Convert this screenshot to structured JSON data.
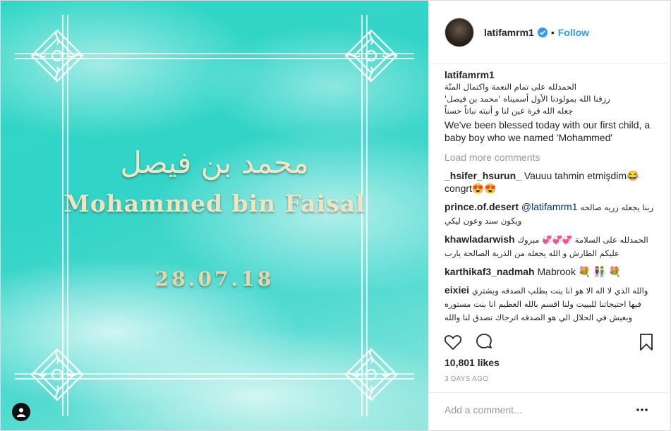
{
  "post": {
    "image": {
      "title_arabic": "محمد بن فيصل",
      "title_english": "Mohammed bin Faisal",
      "date": "28.07.18"
    },
    "header": {
      "username": "latifamrm1",
      "separator": "•",
      "follow_label": "Follow"
    },
    "caption": {
      "username": "latifamrm1",
      "arabic_lines": [
        "الحمدلله على تمام النعمة واكتمال المنّة",
        "رزقنا الله بمولودنا الأول أسميناه 'محمد بن فيصل'",
        "جعله الله قرة عين لنا و أنبته نباتاً حسناً"
      ],
      "english": "We've been blessed today with our first child, a baby boy who we named 'Mohammed'"
    },
    "load_more_label": "Load more comments",
    "comments": [
      {
        "user": "_hsifer_hsurun_",
        "text": "Vauuu tahmin etmişdim😂 congrt😍😍"
      },
      {
        "user": "prince.of.desert",
        "mention": "@latifamrm1",
        "text": "ربنا يجعله زريه صالحه ويكون سند وعون ليكي"
      },
      {
        "user": "khawladarwish",
        "text": "الحمدلله على السلامة 💞💞💞 مبروك عليكم الطارش و الله يجعله من الذرية الصالحة يارب"
      },
      {
        "user": "karthikaf3_nadmah",
        "text": "Mabrook 💐 👫 💐"
      },
      {
        "user": "eixiei",
        "text": "والله الذي لا اله الا هو انا بنت بطلب الصدقه وبشتري فيها احتيجاتنا للبييت ولنا اقسم بالله العظيم انا بنت مستوره وبعيش في الحلال الي هو الصدقه اترجاك تصدق لنا والله العظيم مستحقون لها وهذه شهاده حق"
      }
    ],
    "likes_label": "10,801 likes",
    "timestamp": "3 DAYS AGO",
    "add_comment_placeholder": "Add a comment...",
    "colors": {
      "follow": "#3897f0",
      "verified": "#3897f0",
      "muted": "#999999",
      "text": "#262626"
    },
    "icons": [
      "heart-icon",
      "comment-icon",
      "bookmark-icon",
      "more-options-icon",
      "verified-badge-icon",
      "user-tag-icon"
    ]
  }
}
